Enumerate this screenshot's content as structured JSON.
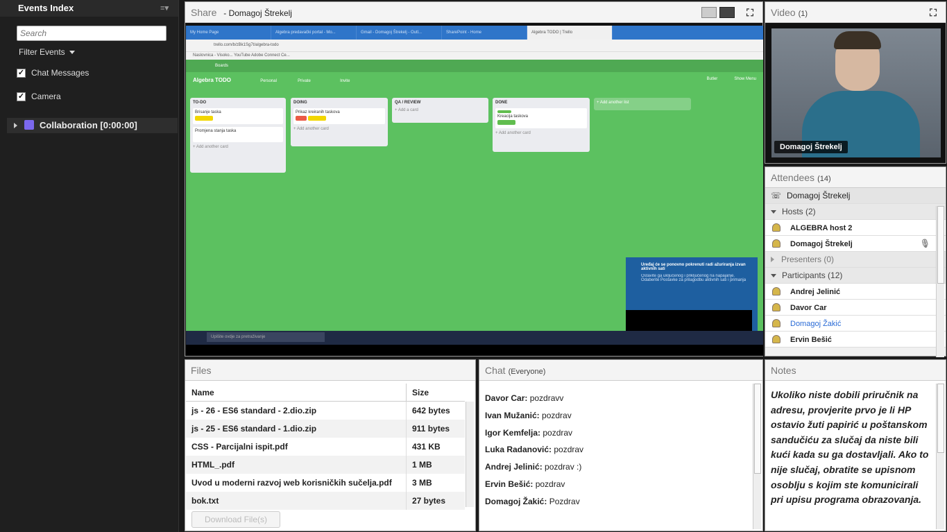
{
  "events_index": {
    "title": "Events Index",
    "menu": "≡▾",
    "search_placeholder": "Search",
    "filter_label": "Filter Events",
    "filters": [
      {
        "label": "Chat Messages",
        "checked": true
      },
      {
        "label": "Camera",
        "checked": true
      }
    ],
    "collaboration": "Collaboration [0:00:00]"
  },
  "share": {
    "title": "Share",
    "presenter": "- Domagoj Štrekelj",
    "screen": {
      "tabs": [
        "My Home Page",
        "Algebra predavački portal - Mo...",
        "Gmail - Domagoj Štrekelj - Outl...",
        "SharePoint - Home",
        "Algebra TODO | Trello"
      ],
      "url": "trello.com/b/zBk1Sg7t/algebra-todo",
      "bookmarks": "Naslovnica - Visoko...   YouTube   Adobe Connect Ce...",
      "trello_bar": "Boards",
      "board_title": "Algebra TODO",
      "board_buttons": [
        "Personal",
        "Private",
        "Invite"
      ],
      "right_buttons": [
        "Butler",
        "Show Menu"
      ],
      "lists": [
        {
          "title": "TO-DO",
          "cards": [
            "Brisanje taska",
            "Promjena stanja taska"
          ],
          "add": "+ Add another card"
        },
        {
          "title": "DOING",
          "cards": [
            "Prikaz kreiranih taskova"
          ],
          "add": "+ Add another card"
        },
        {
          "title": "QA / REVIEW",
          "cards": [],
          "add": "+ Add a card"
        },
        {
          "title": "DONE",
          "cards": [
            "Kreacija taskova"
          ],
          "add": "+ Add another card"
        }
      ],
      "add_list": "+ Add another list",
      "notification": "Uređaj će se ponovno pokrenuti radi ažuriranja izvan aktivnih sati",
      "notification_sub": "Ostavite ga uključenog i priključenog na napajanje. Odaberite Postavke za prilagodbu aktivnih sati i primanja",
      "taskbar_search": "Upišite ovdje za pretraživanje"
    }
  },
  "video": {
    "title": "Video",
    "count": "(1)",
    "name": "Domagoj Štrekelj"
  },
  "attendees": {
    "title": "Attendees",
    "count": "(14)",
    "me": "Domagoj Štrekelj",
    "hosts_label": "Hosts (2)",
    "hosts": [
      "ALGEBRA host 2",
      "Domagoj Štrekelj"
    ],
    "presenters_label": "Presenters (0)",
    "participants_label": "Participants (12)",
    "participants": [
      "Andrej Jelinić",
      "Davor Car",
      "Domagoj Žakić",
      "Ervin Bešić"
    ]
  },
  "files": {
    "title": "Files",
    "col_name": "Name",
    "col_size": "Size",
    "rows": [
      {
        "name": "js - 26 - ES6 standard - 2.dio.zip",
        "size": "642 bytes"
      },
      {
        "name": "js - 25 - ES6 standard - 1.dio.zip",
        "size": "911 bytes"
      },
      {
        "name": "CSS - Parcijalni ispit.pdf",
        "size": "431 KB"
      },
      {
        "name": "HTML_.pdf",
        "size": "1 MB"
      },
      {
        "name": "Uvod u moderni razvoj web korisničkih sučelja.pdf",
        "size": "3 MB"
      },
      {
        "name": "bok.txt",
        "size": "27 bytes"
      }
    ],
    "download_label": "Download File(s)"
  },
  "chat": {
    "title": "Chat",
    "scope": "(Everyone)",
    "messages": [
      {
        "from": "Davor Car:",
        "text": " pozdravv"
      },
      {
        "from": "Ivan Mužanić:",
        "text": " pozdrav"
      },
      {
        "from": "Igor Kemfelja:",
        "text": " pozdrav"
      },
      {
        "from": "Luka Radanović:",
        "text": " pozdrav"
      },
      {
        "from": "Andrej Jelinić:",
        "text": " pozdrav :)"
      },
      {
        "from": "Ervin Bešić:",
        "text": " pozdrav"
      },
      {
        "from": "Domagoj Žakić:",
        "text": " Pozdrav"
      }
    ]
  },
  "notes": {
    "title": "Notes",
    "text": "Ukoliko niste dobili priručnik na adresu, provjerite prvo je li HP ostavio žuti papirić u poštanskom sandučiću za slučaj da niste bili kući kada su ga dostavljali. Ako to nije slučaj, obratite se upisnom osoblju s kojim ste komunicirali pri upisu programa obrazovanja."
  },
  "colors": {
    "trello_green": "#5cc160",
    "link_blue": "#2a6bd6"
  }
}
